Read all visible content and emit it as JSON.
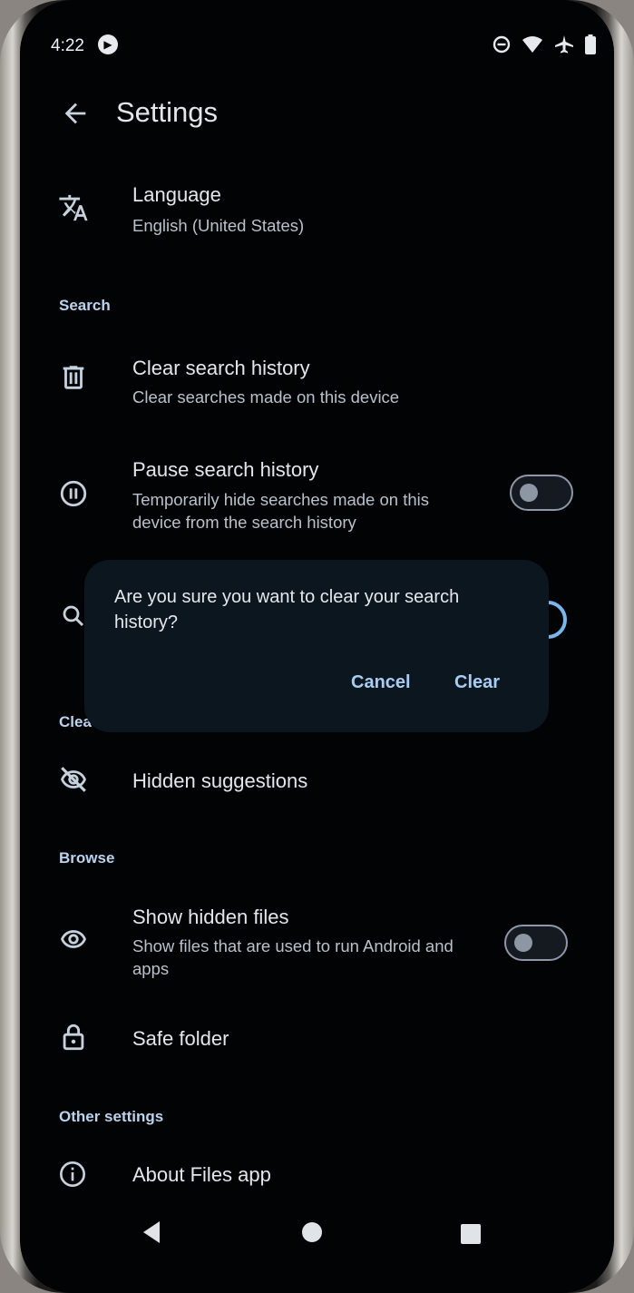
{
  "status_bar": {
    "time": "4:22",
    "icons": [
      "media-icon",
      "do-not-disturb-icon",
      "wifi-icon",
      "airplane-icon",
      "battery-icon"
    ]
  },
  "app_bar": {
    "title": "Settings",
    "back_icon": "arrow-back-icon"
  },
  "settings": {
    "language": {
      "title": "Language",
      "value": "English (United States)",
      "icon": "translate-icon"
    },
    "search_header": "Search",
    "clear_search_history": {
      "title": "Clear search history",
      "subtitle": "Clear searches made on this device",
      "icon": "trash-icon"
    },
    "pause_search_history": {
      "title": "Pause search history",
      "subtitle": "Temporarily hide searches made on this device from the search history",
      "icon": "pause-circle-icon",
      "enabled": false
    },
    "partial_header": "Clea",
    "hidden_suggestions": {
      "title": "Hidden suggestions",
      "icon": "eye-off-icon"
    },
    "browse_header": "Browse",
    "show_hidden_files": {
      "title": "Show hidden files",
      "subtitle": "Show files that are used to run Android and apps",
      "icon": "eye-icon",
      "enabled": false
    },
    "safe_folder": {
      "title": "Safe folder",
      "icon": "lock-icon"
    },
    "other_header": "Other settings",
    "about": {
      "title": "About Files app",
      "icon": "info-icon"
    }
  },
  "dialog": {
    "message": "Are you sure you want to clear your search history?",
    "cancel_label": "Cancel",
    "confirm_label": "Clear"
  },
  "nav_bar": {
    "icons": [
      "nav-back-icon",
      "nav-home-icon",
      "nav-recents-icon"
    ]
  },
  "colors": {
    "background": "#020304",
    "dialog": "#0c161f",
    "accent": "#a8cdf3",
    "section_header": "#bcd3ee"
  }
}
